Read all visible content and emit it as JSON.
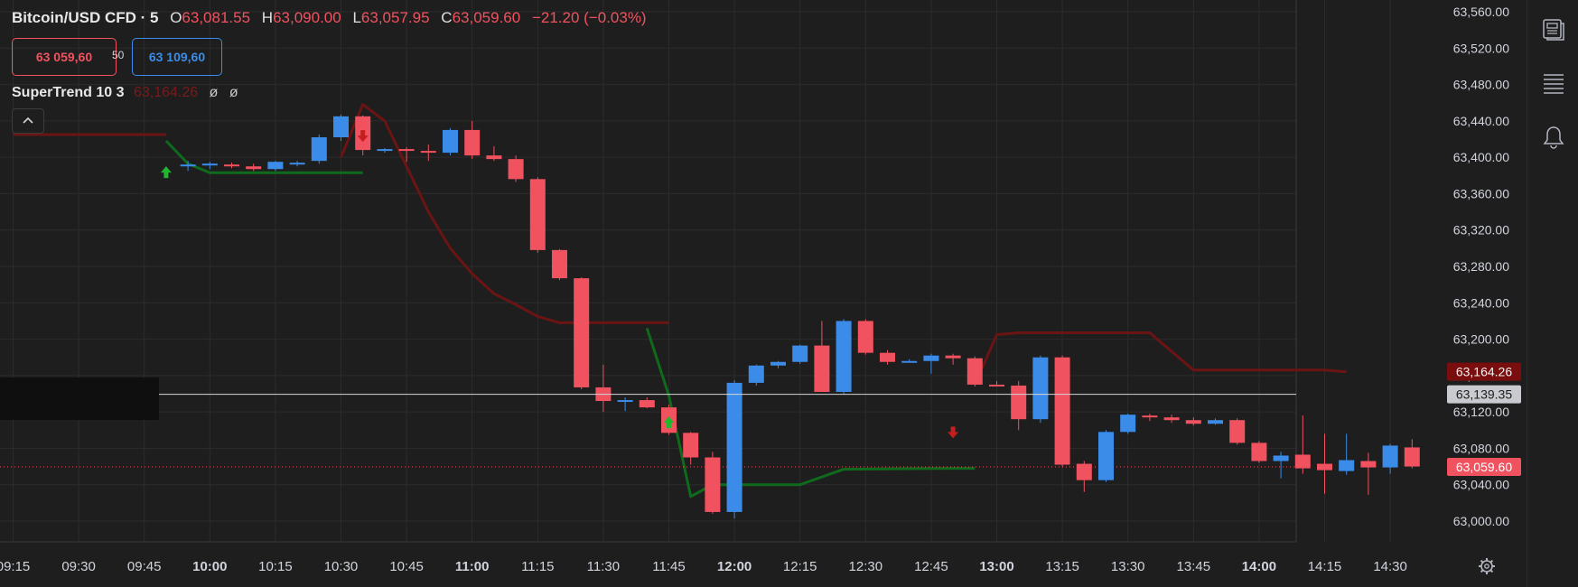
{
  "legend": {
    "symbol": "Bitcoin/USD CFD · 5",
    "open_label": "O",
    "open": "63,081.55",
    "high_label": "H",
    "high": "63,090.00",
    "low_label": "L",
    "low": "63,057.95",
    "close_label": "C",
    "close": "63,059.60",
    "change": "−21.20 (−0.03%)"
  },
  "trade": {
    "sell_price": "63 059,60",
    "spread": "50",
    "buy_price": "63 109,60"
  },
  "indicator": {
    "name": "SuperTrend 10 3",
    "value": "63,164.26",
    "sym1": "ø",
    "sym2": "ø"
  },
  "collapse_icon": "chevron-up-icon",
  "side_icons": [
    "watchlist-icon",
    "details-list-icon",
    "alert-bell-icon"
  ],
  "settings_icon": "gear-icon",
  "colors": {
    "background": "#1e1e1e",
    "grid": "#2c2c2c",
    "up": "#3b8ce8",
    "down": "#f0525f",
    "supertrend_up": "#0f6b1c",
    "supertrend_down": "#6b1414",
    "arrow_up": "#22b52e",
    "arrow_down": "#c41e1e"
  },
  "chart_data": {
    "type": "candlestick",
    "ylim": [
      62980,
      63565
    ],
    "yticks": [
      "63,560.00",
      "63,520.00",
      "63,480.00",
      "63,440.00",
      "63,400.00",
      "63,360.00",
      "63,320.00",
      "63,280.00",
      "63,240.00",
      "63,200.00",
      "63,160.00",
      "63,120.00",
      "63,080.00",
      "63,040.00",
      "63,000.00"
    ],
    "ytick_values": [
      63560,
      63520,
      63480,
      63440,
      63400,
      63360,
      63320,
      63280,
      63240,
      63200,
      63160,
      63120,
      63080,
      63040,
      63000
    ],
    "xticks": [
      {
        "t": "09:15",
        "bar": -8,
        "bold": false
      },
      {
        "t": "09:30",
        "bar": -5,
        "bold": false
      },
      {
        "t": "09:45",
        "bar": -2,
        "bold": false
      },
      {
        "t": "10:00",
        "bar": 1,
        "bold": true
      },
      {
        "t": "10:15",
        "bar": 4,
        "bold": false
      },
      {
        "t": "10:30",
        "bar": 7,
        "bold": false
      },
      {
        "t": "10:45",
        "bar": 10,
        "bold": false
      },
      {
        "t": "11:00",
        "bar": 13,
        "bold": true
      },
      {
        "t": "11:15",
        "bar": 16,
        "bold": false
      },
      {
        "t": "11:30",
        "bar": 19,
        "bold": false
      },
      {
        "t": "11:45",
        "bar": 22,
        "bold": false
      },
      {
        "t": "12:00",
        "bar": 25,
        "bold": true
      },
      {
        "t": "12:15",
        "bar": 28,
        "bold": false
      },
      {
        "t": "12:30",
        "bar": 31,
        "bold": false
      },
      {
        "t": "12:45",
        "bar": 34,
        "bold": false
      },
      {
        "t": "13:00",
        "bar": 37,
        "bold": true
      },
      {
        "t": "13:15",
        "bar": 40,
        "bold": false
      },
      {
        "t": "13:30",
        "bar": 43,
        "bold": false
      },
      {
        "t": "13:45",
        "bar": 46,
        "bold": false
      },
      {
        "t": "14:00",
        "bar": 49,
        "bold": true
      },
      {
        "t": "14:15",
        "bar": 52,
        "bold": false
      },
      {
        "t": "14:30",
        "bar": 55,
        "bold": false
      }
    ],
    "candles": [
      {
        "o": 63390,
        "h": 63396,
        "l": 63385,
        "c": 63392
      },
      {
        "o": 63391,
        "h": 63395,
        "l": 63387,
        "c": 63393
      },
      {
        "o": 63392,
        "h": 63394,
        "l": 63388,
        "c": 63390
      },
      {
        "o": 63390,
        "h": 63393,
        "l": 63385,
        "c": 63387
      },
      {
        "o": 63387,
        "h": 63396,
        "l": 63385,
        "c": 63395
      },
      {
        "o": 63393,
        "h": 63396,
        "l": 63390,
        "c": 63394
      },
      {
        "o": 63396,
        "h": 63425,
        "l": 63393,
        "c": 63422
      },
      {
        "o": 63422,
        "h": 63447,
        "l": 63418,
        "c": 63445
      },
      {
        "o": 63445,
        "h": 63446,
        "l": 63402,
        "c": 63408
      },
      {
        "o": 63407,
        "h": 63410,
        "l": 63405,
        "c": 63409
      },
      {
        "o": 63409,
        "h": 63411,
        "l": 63395,
        "c": 63407
      },
      {
        "o": 63407,
        "h": 63414,
        "l": 63396,
        "c": 63405
      },
      {
        "o": 63405,
        "h": 63432,
        "l": 63402,
        "c": 63430
      },
      {
        "o": 63430,
        "h": 63440,
        "l": 63398,
        "c": 63402
      },
      {
        "o": 63402,
        "h": 63412,
        "l": 63396,
        "c": 63398
      },
      {
        "o": 63398,
        "h": 63402,
        "l": 63373,
        "c": 63376
      },
      {
        "o": 63376,
        "h": 63378,
        "l": 63295,
        "c": 63298
      },
      {
        "o": 63298,
        "h": 63299,
        "l": 63265,
        "c": 63267
      },
      {
        "o": 63267,
        "h": 63268,
        "l": 63145,
        "c": 63147
      },
      {
        "o": 63147,
        "h": 63172,
        "l": 63120,
        "c": 63132
      },
      {
        "o": 63132,
        "h": 63136,
        "l": 63121,
        "c": 63133
      },
      {
        "o": 63133,
        "h": 63136,
        "l": 63124,
        "c": 63125
      },
      {
        "o": 63125,
        "h": 63128,
        "l": 63095,
        "c": 63097
      },
      {
        "o": 63097,
        "h": 63098,
        "l": 63062,
        "c": 63070
      },
      {
        "o": 63070,
        "h": 63076,
        "l": 63008,
        "c": 63010
      },
      {
        "o": 63010,
        "h": 63155,
        "l": 63003,
        "c": 63152
      },
      {
        "o": 63152,
        "h": 63172,
        "l": 63149,
        "c": 63171
      },
      {
        "o": 63171,
        "h": 63176,
        "l": 63168,
        "c": 63175
      },
      {
        "o": 63175,
        "h": 63194,
        "l": 63173,
        "c": 63193
      },
      {
        "o": 63193,
        "h": 63220,
        "l": 63142,
        "c": 63142
      },
      {
        "o": 63142,
        "h": 63222,
        "l": 63140,
        "c": 63220
      },
      {
        "o": 63220,
        "h": 63222,
        "l": 63183,
        "c": 63185
      },
      {
        "o": 63185,
        "h": 63188,
        "l": 63172,
        "c": 63175
      },
      {
        "o": 63175,
        "h": 63178,
        "l": 63175,
        "c": 63176
      },
      {
        "o": 63176,
        "h": 63184,
        "l": 63162,
        "c": 63182
      },
      {
        "o": 63182,
        "h": 63184,
        "l": 63172,
        "c": 63179
      },
      {
        "o": 63179,
        "h": 63181,
        "l": 63148,
        "c": 63150
      },
      {
        "o": 63150,
        "h": 63154,
        "l": 63148,
        "c": 63149
      },
      {
        "o": 63149,
        "h": 63154,
        "l": 63100,
        "c": 63112
      },
      {
        "o": 63112,
        "h": 63182,
        "l": 63108,
        "c": 63180
      },
      {
        "o": 63180,
        "h": 63182,
        "l": 63060,
        "c": 63062
      },
      {
        "o": 63063,
        "h": 63066,
        "l": 63032,
        "c": 63045
      },
      {
        "o": 63045,
        "h": 63100,
        "l": 63043,
        "c": 63098
      },
      {
        "o": 63098,
        "h": 63118,
        "l": 63096,
        "c": 63117
      },
      {
        "o": 63116,
        "h": 63118,
        "l": 63110,
        "c": 63114
      },
      {
        "o": 63114,
        "h": 63117,
        "l": 63108,
        "c": 63111
      },
      {
        "o": 63111,
        "h": 63114,
        "l": 63105,
        "c": 63107
      },
      {
        "o": 63107,
        "h": 63113,
        "l": 63106,
        "c": 63111
      },
      {
        "o": 63111,
        "h": 63113,
        "l": 63084,
        "c": 63086
      },
      {
        "o": 63086,
        "h": 63088,
        "l": 63064,
        "c": 63066
      },
      {
        "o": 63066,
        "h": 63076,
        "l": 63047,
        "c": 63072
      },
      {
        "o": 63073,
        "h": 63116,
        "l": 63052,
        "c": 63058
      },
      {
        "o": 63063,
        "h": 63096,
        "l": 63030,
        "c": 63056
      },
      {
        "o": 63055,
        "h": 63096,
        "l": 63051,
        "c": 63067
      },
      {
        "o": 63066,
        "h": 63075,
        "l": 63029,
        "c": 63059
      },
      {
        "o": 63059,
        "h": 63085,
        "l": 63052,
        "c": 63083
      },
      {
        "o": 63081,
        "h": 63090,
        "l": 63058,
        "c": 63060
      }
    ],
    "supertrend_down_1": [
      [
        -8,
        63425
      ],
      [
        -1,
        63425
      ]
    ],
    "supertrend_up_1": [
      [
        -1,
        63418
      ],
      [
        0,
        63393
      ],
      [
        1,
        63383
      ],
      [
        7,
        63383
      ],
      [
        8,
        63383
      ]
    ],
    "supertrend_down_2": [
      [
        7,
        63400
      ],
      [
        8,
        63458
      ],
      [
        9,
        63440
      ],
      [
        10,
        63390
      ],
      [
        11,
        63340
      ],
      [
        12,
        63300
      ],
      [
        13,
        63272
      ],
      [
        14,
        63250
      ],
      [
        15,
        63238
      ],
      [
        16,
        63225
      ],
      [
        17,
        63218
      ],
      [
        18,
        63218
      ],
      [
        22,
        63218
      ]
    ],
    "supertrend_up_2": [
      [
        21,
        63212
      ],
      [
        22,
        63138
      ],
      [
        23,
        63027
      ],
      [
        24,
        63040
      ],
      [
        28,
        63040
      ],
      [
        30,
        63057
      ],
      [
        35,
        63058
      ],
      [
        36,
        63058
      ]
    ],
    "supertrend_down_3": [
      [
        36,
        63150
      ],
      [
        37,
        63205
      ],
      [
        38,
        63207
      ],
      [
        44,
        63207
      ],
      [
        46,
        63166
      ],
      [
        52,
        63166
      ],
      [
        53,
        63164
      ]
    ],
    "signals": [
      {
        "type": "buy",
        "bar": -1,
        "price": 63398
      },
      {
        "type": "sell",
        "bar": 8,
        "price": 63408
      },
      {
        "type": "buy",
        "bar": 22,
        "price": 63123
      },
      {
        "type": "sell",
        "bar": 35,
        "price": 63082
      }
    ],
    "price_labels": [
      {
        "name": "supertrend-value",
        "value": "63,164.26",
        "price": 63164.26,
        "bg": "#7a0e0e",
        "fg": "#f2f2f2"
      },
      {
        "name": "crosshair-price",
        "value": "63,139.35",
        "price": 63139.35,
        "bg": "#c9cbd0",
        "fg": "#1e1e1e"
      },
      {
        "name": "last-price",
        "value": "63,059.60",
        "price": 63059.6,
        "bg": "#f0525f",
        "fg": "#ffffff"
      }
    ],
    "crosshair_price": 63139.35,
    "last_price": 63059.6
  }
}
